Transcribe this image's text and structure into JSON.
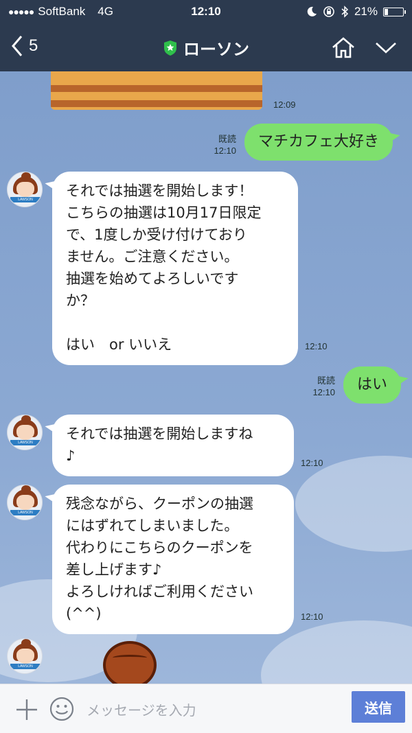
{
  "status": {
    "carrier": "SoftBank",
    "network": "4G",
    "time": "12:10",
    "battery": "21%",
    "battery_level": 0.21
  },
  "nav": {
    "back_count": "5",
    "title": "ローソン"
  },
  "messages": {
    "m0": {
      "time": "12:09"
    },
    "m1": {
      "read": "既読",
      "time": "12:10",
      "text": "マチカフェ大好き"
    },
    "m2": {
      "time": "12:10",
      "text": "それでは抽選を開始します！\nこちらの抽選は10月17日限定\nで、1度しか受け付けており\nません。ご注意ください。\n抽選を始めてよろしいです\nか？\n\nはい　or いいえ"
    },
    "m3": {
      "read": "既読",
      "time": "12:10",
      "text": "はい"
    },
    "m4": {
      "time": "12:10",
      "text": "それでは抽選を開始しますね\n♪"
    },
    "m5": {
      "time": "12:10",
      "text": "残念ながら、クーポンの抽選\nにはずれてしまいました。\n代わりにこちらのクーポンを\n差し上げます♪\nよろしければご利用ください\n(^^)"
    }
  },
  "avatar": {
    "brand": "LAWSON"
  },
  "input": {
    "placeholder": "メッセージを入力",
    "send_label": "送信"
  },
  "colors": {
    "header": "#2c3a4f",
    "chat_bg": "#7e9cc9",
    "out_bubble": "#7ee06d",
    "send_button": "#5d7fd7"
  }
}
